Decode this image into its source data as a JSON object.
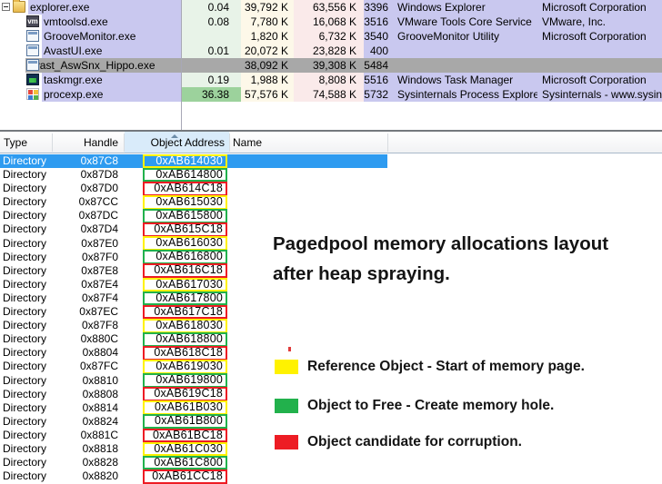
{
  "colors": {
    "selection_blue": "#2E9BF0",
    "selection_gray": "#A8A8A8",
    "own_process_lavender": "#C9C8EF",
    "cpu_column_tint": "#E8F3E8",
    "private_bytes_column_tint": "#FDF8E9",
    "working_set_column_tint": "#FAEAEA",
    "cpu_hot_green": "#9CD29C",
    "sorted_header_blue": "#D9EBFA",
    "highlight_yellow": "#FFF200",
    "highlight_green": "#22B14C",
    "highlight_red": "#ED1C24"
  },
  "process_table": {
    "rows": [
      {
        "name": "explorer.exe",
        "depth": 0,
        "expander": "collapse",
        "icon": "folder-icon",
        "cpu": "0.04",
        "private_bytes": "39,792 K",
        "working_set": "63,556 K",
        "pid": "3396",
        "description": "Windows Explorer",
        "company": "Microsoft Corporation",
        "state": "normal"
      },
      {
        "name": "vmtoolsd.exe",
        "depth": 1,
        "expander": null,
        "icon": "vmware-icon",
        "cpu": "0.08",
        "private_bytes": "7,780 K",
        "working_set": "16,068 K",
        "pid": "3516",
        "description": "VMware Tools Core Service",
        "company": "VMware, Inc.",
        "state": "normal"
      },
      {
        "name": "GrooveMonitor.exe",
        "depth": 1,
        "expander": null,
        "icon": "groove-window-icon",
        "cpu": "",
        "private_bytes": "1,820 K",
        "working_set": "6,732 K",
        "pid": "3540",
        "description": "GrooveMonitor Utility",
        "company": "Microsoft Corporation",
        "state": "normal"
      },
      {
        "name": "AvastUI.exe",
        "depth": 1,
        "expander": null,
        "icon": "avast-ui-window-icon",
        "cpu": "0.01",
        "private_bytes": "20,072 K",
        "working_set": "23,828 K",
        "pid": "400",
        "description": "",
        "company": "",
        "state": "normal"
      },
      {
        "name": "Avast_AswSnx_Hippo.exe",
        "depth": 1,
        "expander": null,
        "icon": "avast-snx-window-icon",
        "cpu": "",
        "private_bytes": "38,092 K",
        "working_set": "39,308 K",
        "pid": "5484",
        "description": "",
        "company": "",
        "state": "selected-gray"
      },
      {
        "name": "taskmgr.exe",
        "depth": 1,
        "expander": null,
        "icon": "taskmgr-icon",
        "cpu": "0.19",
        "private_bytes": "1,988 K",
        "working_set": "8,808 K",
        "pid": "5516",
        "description": "Windows Task Manager",
        "company": "Microsoft Corporation",
        "state": "normal"
      },
      {
        "name": "procexp.exe",
        "depth": 1,
        "expander": null,
        "icon": "procexp-icon",
        "cpu": "36.38",
        "cpu_hot": true,
        "private_bytes": "57,576 K",
        "working_set": "74,588 K",
        "pid": "5732",
        "description": "Sysinternals Process Explorer",
        "company": "Sysinternals - www.sysinter...",
        "state": "normal"
      }
    ]
  },
  "handle_table": {
    "columns": [
      "Type",
      "Handle",
      "Object Address",
      "Name"
    ],
    "sort_column": "Object Address",
    "sort_direction": "ascending",
    "rows": [
      {
        "type": "Directory",
        "handle": "0x87C8",
        "object_address": "0xAB614030",
        "highlight": "yellow",
        "name": "",
        "selected": true
      },
      {
        "type": "Directory",
        "handle": "0x87D8",
        "object_address": "0xAB614800",
        "highlight": "green",
        "name": "",
        "selected": false
      },
      {
        "type": "Directory",
        "handle": "0x87D0",
        "object_address": "0xAB614C18",
        "highlight": "red",
        "name": "",
        "selected": false
      },
      {
        "type": "Directory",
        "handle": "0x87CC",
        "object_address": "0xAB615030",
        "highlight": "yellow",
        "name": "",
        "selected": false
      },
      {
        "type": "Directory",
        "handle": "0x87DC",
        "object_address": "0xAB615800",
        "highlight": "green",
        "name": "",
        "selected": false
      },
      {
        "type": "Directory",
        "handle": "0x87D4",
        "object_address": "0xAB615C18",
        "highlight": "red",
        "name": "",
        "selected": false
      },
      {
        "type": "Directory",
        "handle": "0x87E0",
        "object_address": "0xAB616030",
        "highlight": "yellow",
        "name": "",
        "selected": false
      },
      {
        "type": "Directory",
        "handle": "0x87F0",
        "object_address": "0xAB616800",
        "highlight": "green",
        "name": "",
        "selected": false
      },
      {
        "type": "Directory",
        "handle": "0x87E8",
        "object_address": "0xAB616C18",
        "highlight": "red",
        "name": "",
        "selected": false
      },
      {
        "type": "Directory",
        "handle": "0x87E4",
        "object_address": "0xAB617030",
        "highlight": "yellow",
        "name": "",
        "selected": false
      },
      {
        "type": "Directory",
        "handle": "0x87F4",
        "object_address": "0xAB617800",
        "highlight": "green",
        "name": "",
        "selected": false
      },
      {
        "type": "Directory",
        "handle": "0x87EC",
        "object_address": "0xAB617C18",
        "highlight": "red",
        "name": "",
        "selected": false
      },
      {
        "type": "Directory",
        "handle": "0x87F8",
        "object_address": "0xAB618030",
        "highlight": "yellow",
        "name": "",
        "selected": false
      },
      {
        "type": "Directory",
        "handle": "0x880C",
        "object_address": "0xAB618800",
        "highlight": "green",
        "name": "",
        "selected": false
      },
      {
        "type": "Directory",
        "handle": "0x8804",
        "object_address": "0xAB618C18",
        "highlight": "red",
        "name": "",
        "selected": false
      },
      {
        "type": "Directory",
        "handle": "0x87FC",
        "object_address": "0xAB619030",
        "highlight": "yellow",
        "name": "",
        "selected": false
      },
      {
        "type": "Directory",
        "handle": "0x8810",
        "object_address": "0xAB619800",
        "highlight": "green",
        "name": "",
        "selected": false
      },
      {
        "type": "Directory",
        "handle": "0x8808",
        "object_address": "0xAB619C18",
        "highlight": "red",
        "name": "",
        "selected": false
      },
      {
        "type": "Directory",
        "handle": "0x8814",
        "object_address": "0xAB61B030",
        "highlight": "yellow",
        "name": "",
        "selected": false
      },
      {
        "type": "Directory",
        "handle": "0x8824",
        "object_address": "0xAB61B800",
        "highlight": "green",
        "name": "",
        "selected": false
      },
      {
        "type": "Directory",
        "handle": "0x881C",
        "object_address": "0xAB61BC18",
        "highlight": "red",
        "name": "",
        "selected": false
      },
      {
        "type": "Directory",
        "handle": "0x8818",
        "object_address": "0xAB61C030",
        "highlight": "yellow",
        "name": "",
        "selected": false
      },
      {
        "type": "Directory",
        "handle": "0x8828",
        "object_address": "0xAB61C800",
        "highlight": "green",
        "name": "",
        "selected": false
      },
      {
        "type": "Directory",
        "handle": "0x8820",
        "object_address": "0xAB61CC18",
        "highlight": "red",
        "name": "",
        "selected": false
      }
    ]
  },
  "annotation": {
    "title_line1": "Pagedpool memory allocations layout",
    "title_line2": "after heap spraying.",
    "legend": [
      {
        "color": "#FFF200",
        "label": "Reference Object - Start of memory page."
      },
      {
        "color": "#22B14C",
        "label": "Object to Free - Create memory hole."
      },
      {
        "color": "#ED1C24",
        "label": "Object candidate for corruption."
      }
    ]
  }
}
